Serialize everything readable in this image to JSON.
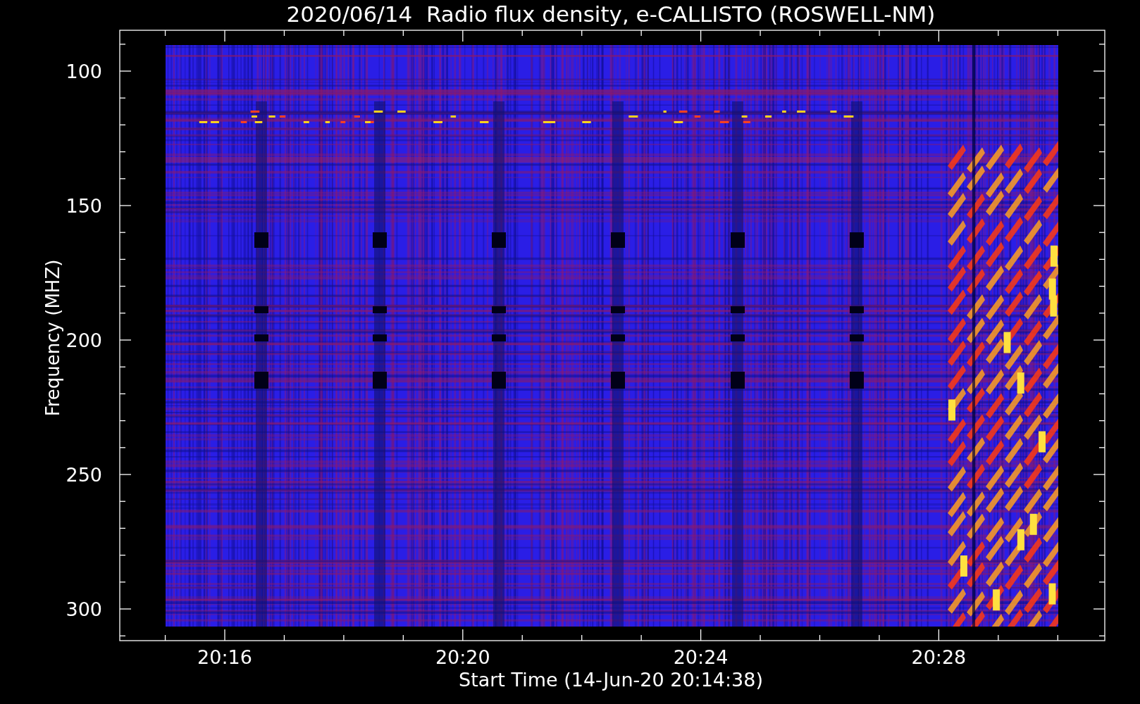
{
  "title": "2020/06/14  Radio flux density, e-CALLISTO (ROSWELL-NM)",
  "y_axis": {
    "label": "Frequency (MHZ)",
    "ticks": [
      "100",
      "150",
      "200",
      "250",
      "300"
    ]
  },
  "x_axis": {
    "label": "Start Time (14-Jun-20 20:14:38)",
    "ticks": [
      "20:16",
      "20:20",
      "20:24",
      "20:28"
    ]
  }
}
